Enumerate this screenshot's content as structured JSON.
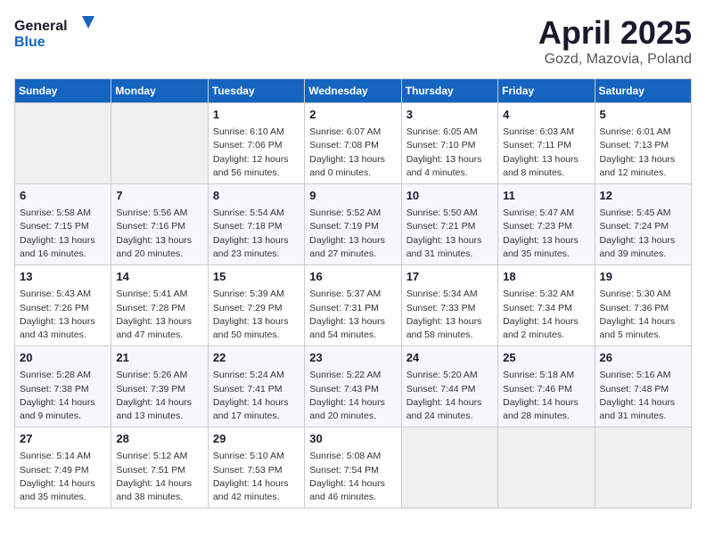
{
  "logo": {
    "general": "General",
    "blue": "Blue"
  },
  "header": {
    "month": "April 2025",
    "location": "Gozd, Mazovia, Poland"
  },
  "weekdays": [
    "Sunday",
    "Monday",
    "Tuesday",
    "Wednesday",
    "Thursday",
    "Friday",
    "Saturday"
  ],
  "weeks": [
    [
      {
        "day": "",
        "info": ""
      },
      {
        "day": "",
        "info": ""
      },
      {
        "day": "1",
        "info": "Sunrise: 6:10 AM\nSunset: 7:06 PM\nDaylight: 12 hours and 56 minutes."
      },
      {
        "day": "2",
        "info": "Sunrise: 6:07 AM\nSunset: 7:08 PM\nDaylight: 13 hours and 0 minutes."
      },
      {
        "day": "3",
        "info": "Sunrise: 6:05 AM\nSunset: 7:10 PM\nDaylight: 13 hours and 4 minutes."
      },
      {
        "day": "4",
        "info": "Sunrise: 6:03 AM\nSunset: 7:11 PM\nDaylight: 13 hours and 8 minutes."
      },
      {
        "day": "5",
        "info": "Sunrise: 6:01 AM\nSunset: 7:13 PM\nDaylight: 13 hours and 12 minutes."
      }
    ],
    [
      {
        "day": "6",
        "info": "Sunrise: 5:58 AM\nSunset: 7:15 PM\nDaylight: 13 hours and 16 minutes."
      },
      {
        "day": "7",
        "info": "Sunrise: 5:56 AM\nSunset: 7:16 PM\nDaylight: 13 hours and 20 minutes."
      },
      {
        "day": "8",
        "info": "Sunrise: 5:54 AM\nSunset: 7:18 PM\nDaylight: 13 hours and 23 minutes."
      },
      {
        "day": "9",
        "info": "Sunrise: 5:52 AM\nSunset: 7:19 PM\nDaylight: 13 hours and 27 minutes."
      },
      {
        "day": "10",
        "info": "Sunrise: 5:50 AM\nSunset: 7:21 PM\nDaylight: 13 hours and 31 minutes."
      },
      {
        "day": "11",
        "info": "Sunrise: 5:47 AM\nSunset: 7:23 PM\nDaylight: 13 hours and 35 minutes."
      },
      {
        "day": "12",
        "info": "Sunrise: 5:45 AM\nSunset: 7:24 PM\nDaylight: 13 hours and 39 minutes."
      }
    ],
    [
      {
        "day": "13",
        "info": "Sunrise: 5:43 AM\nSunset: 7:26 PM\nDaylight: 13 hours and 43 minutes."
      },
      {
        "day": "14",
        "info": "Sunrise: 5:41 AM\nSunset: 7:28 PM\nDaylight: 13 hours and 47 minutes."
      },
      {
        "day": "15",
        "info": "Sunrise: 5:39 AM\nSunset: 7:29 PM\nDaylight: 13 hours and 50 minutes."
      },
      {
        "day": "16",
        "info": "Sunrise: 5:37 AM\nSunset: 7:31 PM\nDaylight: 13 hours and 54 minutes."
      },
      {
        "day": "17",
        "info": "Sunrise: 5:34 AM\nSunset: 7:33 PM\nDaylight: 13 hours and 58 minutes."
      },
      {
        "day": "18",
        "info": "Sunrise: 5:32 AM\nSunset: 7:34 PM\nDaylight: 14 hours and 2 minutes."
      },
      {
        "day": "19",
        "info": "Sunrise: 5:30 AM\nSunset: 7:36 PM\nDaylight: 14 hours and 5 minutes."
      }
    ],
    [
      {
        "day": "20",
        "info": "Sunrise: 5:28 AM\nSunset: 7:38 PM\nDaylight: 14 hours and 9 minutes."
      },
      {
        "day": "21",
        "info": "Sunrise: 5:26 AM\nSunset: 7:39 PM\nDaylight: 14 hours and 13 minutes."
      },
      {
        "day": "22",
        "info": "Sunrise: 5:24 AM\nSunset: 7:41 PM\nDaylight: 14 hours and 17 minutes."
      },
      {
        "day": "23",
        "info": "Sunrise: 5:22 AM\nSunset: 7:43 PM\nDaylight: 14 hours and 20 minutes."
      },
      {
        "day": "24",
        "info": "Sunrise: 5:20 AM\nSunset: 7:44 PM\nDaylight: 14 hours and 24 minutes."
      },
      {
        "day": "25",
        "info": "Sunrise: 5:18 AM\nSunset: 7:46 PM\nDaylight: 14 hours and 28 minutes."
      },
      {
        "day": "26",
        "info": "Sunrise: 5:16 AM\nSunset: 7:48 PM\nDaylight: 14 hours and 31 minutes."
      }
    ],
    [
      {
        "day": "27",
        "info": "Sunrise: 5:14 AM\nSunset: 7:49 PM\nDaylight: 14 hours and 35 minutes."
      },
      {
        "day": "28",
        "info": "Sunrise: 5:12 AM\nSunset: 7:51 PM\nDaylight: 14 hours and 38 minutes."
      },
      {
        "day": "29",
        "info": "Sunrise: 5:10 AM\nSunset: 7:53 PM\nDaylight: 14 hours and 42 minutes."
      },
      {
        "day": "30",
        "info": "Sunrise: 5:08 AM\nSunset: 7:54 PM\nDaylight: 14 hours and 46 minutes."
      },
      {
        "day": "",
        "info": ""
      },
      {
        "day": "",
        "info": ""
      },
      {
        "day": "",
        "info": ""
      }
    ]
  ]
}
